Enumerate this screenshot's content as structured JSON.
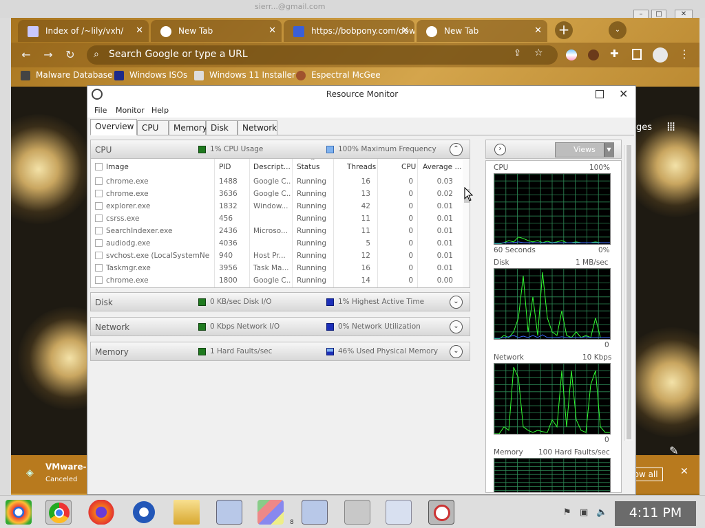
{
  "host": {
    "title_text": "sierr...@gmail.com",
    "min": "–",
    "max": "□",
    "close": "✕"
  },
  "browser": {
    "tabs": [
      {
        "label": "Index of /~lily/vxh/",
        "close": "✕"
      },
      {
        "label": "New Tab",
        "close": "✕"
      },
      {
        "label": "https://bobpony.com/dow",
        "close": "✕"
      },
      {
        "label": "New Tab",
        "close": "✕"
      }
    ],
    "new_tab": "+",
    "tab_menu": "⌄",
    "back": "←",
    "forward": "→",
    "reload": "↻",
    "omnibox_placeholder": "Search Google or type a URL",
    "bookmarks": [
      "Malware Database",
      "Windows ISOs",
      "Windows 11 Installer",
      "Espectral McGee"
    ],
    "gmail_partial": "ges",
    "download": {
      "name": "VMware-w",
      "status": "Canceled",
      "show_all": "how all",
      "close": "✕"
    }
  },
  "rm": {
    "title": "Resource Monitor",
    "menus": [
      "File",
      "Monitor",
      "Help"
    ],
    "tabs": [
      "Overview",
      "CPU",
      "Memory",
      "Disk",
      "Network"
    ],
    "cpu_section": {
      "title": "CPU",
      "stat1": "1% CPU Usage",
      "stat2": "100% Maximum Frequency",
      "chev": "⌃"
    },
    "columns": [
      "Image",
      "PID",
      "Descript...",
      "Status",
      "Threads",
      "CPU",
      "Average ..."
    ],
    "rows": [
      {
        "image": "chrome.exe",
        "pid": "1488",
        "desc": "Google C...",
        "status": "Running",
        "threads": "16",
        "cpu": "0",
        "avg": "0.03"
      },
      {
        "image": "chrome.exe",
        "pid": "3636",
        "desc": "Google C...",
        "status": "Running",
        "threads": "13",
        "cpu": "0",
        "avg": "0.02"
      },
      {
        "image": "explorer.exe",
        "pid": "1832",
        "desc": "Window...",
        "status": "Running",
        "threads": "42",
        "cpu": "0",
        "avg": "0.01"
      },
      {
        "image": "csrss.exe",
        "pid": "456",
        "desc": "",
        "status": "Running",
        "threads": "11",
        "cpu": "0",
        "avg": "0.01"
      },
      {
        "image": "SearchIndexer.exe",
        "pid": "2436",
        "desc": "Microso...",
        "status": "Running",
        "threads": "11",
        "cpu": "0",
        "avg": "0.01"
      },
      {
        "image": "audiodg.exe",
        "pid": "4036",
        "desc": "",
        "status": "Running",
        "threads": "5",
        "cpu": "0",
        "avg": "0.01"
      },
      {
        "image": "svchost.exe (LocalSystemNetw...",
        "pid": "940",
        "desc": "Host Pr...",
        "status": "Running",
        "threads": "12",
        "cpu": "0",
        "avg": "0.01"
      },
      {
        "image": "Taskmgr.exe",
        "pid": "3956",
        "desc": "Task Ma...",
        "status": "Running",
        "threads": "16",
        "cpu": "0",
        "avg": "0.01"
      },
      {
        "image": "chrome.exe",
        "pid": "1800",
        "desc": "Google C...",
        "status": "Running",
        "threads": "14",
        "cpu": "0",
        "avg": "0.00"
      }
    ],
    "disk_section": {
      "title": "Disk",
      "stat1": "0 KB/sec Disk I/O",
      "stat2": "1% Highest Active Time",
      "chev": "⌄"
    },
    "network_section": {
      "title": "Network",
      "stat1": "0 Kbps Network I/O",
      "stat2": "0% Network Utilization",
      "chev": "⌄"
    },
    "memory_section": {
      "title": "Memory",
      "stat1": "1 Hard Faults/sec",
      "stat2": "46% Used Physical Memory",
      "chev": "⌄"
    },
    "views_label": "Views",
    "graphs": {
      "cpu_label": "CPU",
      "cpu_max": "100%",
      "cpu_time": "60 Seconds",
      "cpu_min": "0%",
      "disk_label": "Disk",
      "disk_max": "1 MB/sec",
      "disk_min": "0",
      "network_label": "Network",
      "network_max": "10 Kbps",
      "network_min": "0",
      "memory_label": "Memory",
      "memory_max": "100 Hard Faults/sec"
    },
    "colors": {
      "grid": "#2e8b57",
      "line": "#33ff33",
      "line2": "#3b6cff",
      "green_sq": "#1f7a1f",
      "blue_sq": "#3b5bd8"
    }
  },
  "taskbar": {
    "clock": "4:11 PM",
    "badge": "8"
  }
}
